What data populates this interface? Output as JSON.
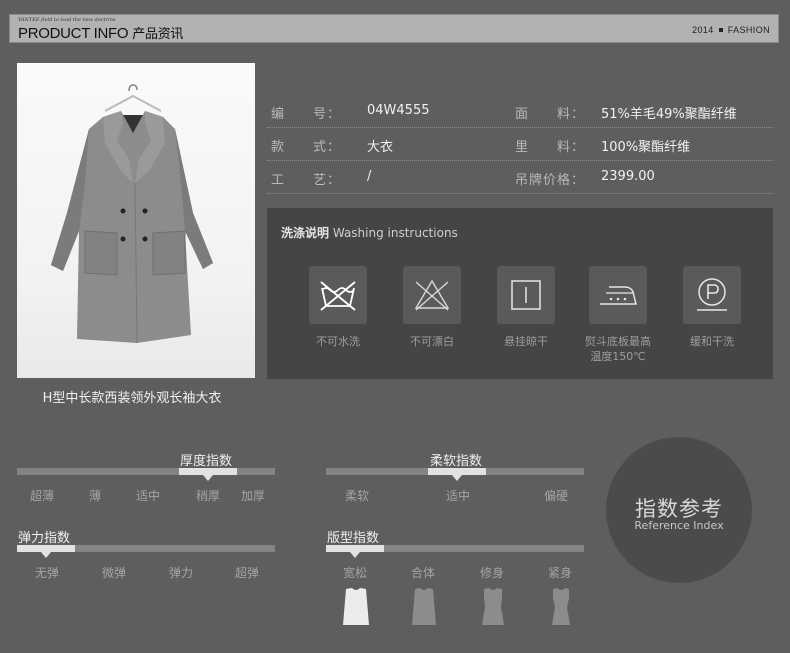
{
  "header": {
    "tagline": "YANTEE field to lead the new doctrine",
    "title_en": "PRODUCT INFO",
    "title_zh": "产品资讯",
    "year": "2014",
    "right_label": "FASHION"
  },
  "product": {
    "caption": "H型中长款西装领外观长袖大衣",
    "image": "coat-photo"
  },
  "info_rows": [
    {
      "label1": "编　　号：",
      "value1": "04W4555",
      "label2": "面　　料：",
      "value2": "51%羊毛49%聚酯纤维"
    },
    {
      "label1": "款　　式：",
      "value1": "大衣",
      "label2": "里　　料：",
      "value2": "100%聚酯纤维"
    },
    {
      "label1": "工　　艺：",
      "value1": "/",
      "label2": "吊牌价格：",
      "value2": "2399.00"
    }
  ],
  "washing": {
    "title_zh": "洗涤说明",
    "title_en": "Washing instructions",
    "items": [
      {
        "icon": "no-wash-icon",
        "label": "不可水洗"
      },
      {
        "icon": "no-bleach-icon",
        "label": "不可漂白"
      },
      {
        "icon": "hang-dry-icon",
        "label": "悬挂晾干"
      },
      {
        "icon": "iron-150-icon",
        "label1": "熨斗底板最高",
        "label2": "温度150℃"
      },
      {
        "icon": "gentle-dry-clean-icon",
        "label": "缓和干洗"
      }
    ]
  },
  "indices": {
    "thickness": {
      "title": "厚度指数",
      "ticks": [
        "超薄",
        "薄",
        "适中",
        "稍厚",
        "加厚"
      ],
      "selected": "稍厚"
    },
    "softness": {
      "title": "柔软指数",
      "ticks": [
        "柔软",
        "适中",
        "偏硬"
      ],
      "selected": "适中"
    },
    "elasticity": {
      "title": "弹力指数",
      "ticks": [
        "无弹",
        "微弹",
        "弹力",
        "超弹"
      ],
      "selected": "无弹"
    },
    "fit": {
      "title": "版型指数",
      "ticks": [
        "宽松",
        "合体",
        "修身",
        "紧身"
      ],
      "selected": "宽松"
    }
  },
  "reference": {
    "zh": "指数参考",
    "en": "Reference Index"
  },
  "colors": {
    "background": "#5e5e5e",
    "panel": "#454545",
    "highlight": "#e2e2e2",
    "track": "#848484"
  }
}
